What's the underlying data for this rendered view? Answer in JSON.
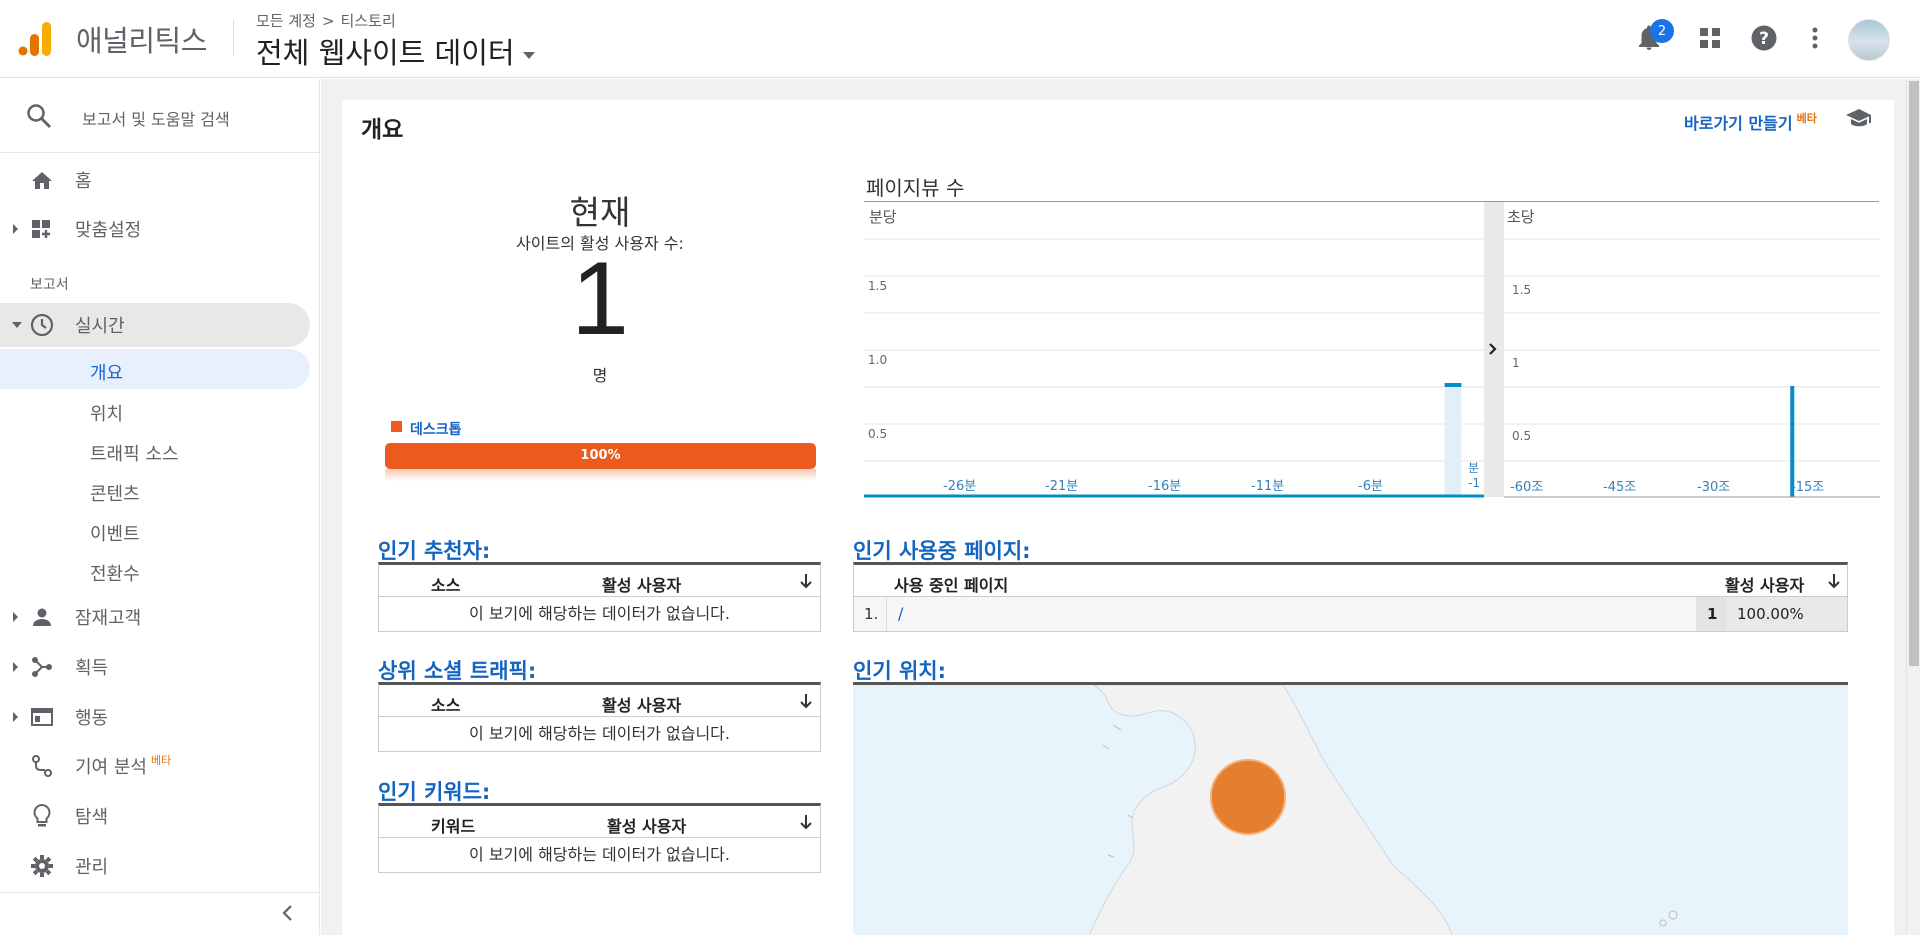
{
  "header": {
    "brand": "애널리틱스",
    "breadcrumb_account": "모든 계정",
    "breadcrumb_property": "티스토리",
    "view_name": "전체 웹사이트 데이터",
    "notification_count": "2"
  },
  "sidebar": {
    "search_placeholder": "보고서 및 도움말 검색",
    "home": "홈",
    "customization": "맞춤설정",
    "reports_section": "보고서",
    "realtime": "실시간",
    "realtime_items": [
      "개요",
      "위치",
      "트래픽 소스",
      "콘텐츠",
      "이벤트",
      "전환수"
    ],
    "audience": "잠재고객",
    "acquisition": "획득",
    "behavior": "행동",
    "attribution": "기여 분석",
    "attribution_badge": "베타",
    "discover": "탐색",
    "admin": "관리"
  },
  "page": {
    "title": "개요",
    "shortcut": "바로가기 만들기",
    "shortcut_badge": "베타"
  },
  "now": {
    "title": "현재",
    "subtitle": "사이트의 활성 사용자 수:",
    "value": "1",
    "unit": "명",
    "device_label": "데스크톱",
    "device_percent_label": "100%",
    "device_share": 1.0,
    "device_color": "#ec5a1e"
  },
  "pageviews": {
    "title": "페이지뷰 수",
    "per_minute_label": "분당",
    "per_second_label": "초당",
    "minute_yticks": [
      "1.5",
      "1.0",
      "0.5"
    ],
    "second_yticks": [
      "1.5",
      "1",
      "0.5"
    ],
    "minute_xticks": [
      "-26분",
      "-21분",
      "-16분",
      "-11분",
      "-6분"
    ],
    "minute_last_tick": [
      "분",
      "-1"
    ],
    "second_xticks": [
      "-60조",
      "-45조",
      "-30조",
      "-15조"
    ]
  },
  "chart_data": [
    {
      "type": "bar",
      "title": "분당",
      "x": [
        -30,
        -29,
        -28,
        -27,
        -26,
        -25,
        -24,
        -23,
        -22,
        -21,
        -20,
        -19,
        -18,
        -17,
        -16,
        -15,
        -14,
        -13,
        -12,
        -11,
        -10,
        -9,
        -8,
        -7,
        -6,
        -5,
        -4,
        -3,
        -2,
        -1
      ],
      "values": [
        0,
        0,
        0,
        0,
        0,
        0,
        0,
        0,
        0,
        0,
        0,
        0,
        0,
        0,
        0,
        0,
        0,
        0,
        0,
        0,
        0,
        0,
        0,
        0,
        0,
        0,
        0,
        0,
        1,
        0
      ],
      "ylim": [
        0,
        2
      ],
      "color": "#058dc7"
    },
    {
      "type": "bar",
      "title": "초당",
      "x_range": [
        -60,
        0
      ],
      "spike_at": -14,
      "values_note_value": 1,
      "ylim": [
        0,
        2
      ],
      "color": "#058dc7"
    }
  ],
  "tables": {
    "referrers": {
      "title": "인기 추천자:",
      "columns": [
        "소스",
        "활성 사용자"
      ],
      "empty": "이 보기에 해당하는 데이터가 없습니다."
    },
    "social": {
      "title": "상위 소셜 트래픽:",
      "columns": [
        "소스",
        "활성 사용자"
      ],
      "empty": "이 보기에 해당하는 데이터가 없습니다."
    },
    "keywords": {
      "title": "인기 키워드:",
      "columns": [
        "키워드",
        "활성 사용자"
      ],
      "empty": "이 보기에 해당하는 데이터가 없습니다."
    },
    "pages": {
      "title": "인기 사용중 페이지:",
      "columns": [
        "사용 중인 페이지",
        "활성 사용자"
      ],
      "rows": [
        {
          "index": "1.",
          "page": "/",
          "users": "1",
          "percent": "100.00%"
        }
      ]
    },
    "locations": {
      "title": "인기 위치:"
    }
  },
  "colors": {
    "accent_blue": "#1565c0",
    "chart_blue": "#058dc7",
    "orange": "#ec5a1e",
    "map_bubble": "#e67e30"
  }
}
